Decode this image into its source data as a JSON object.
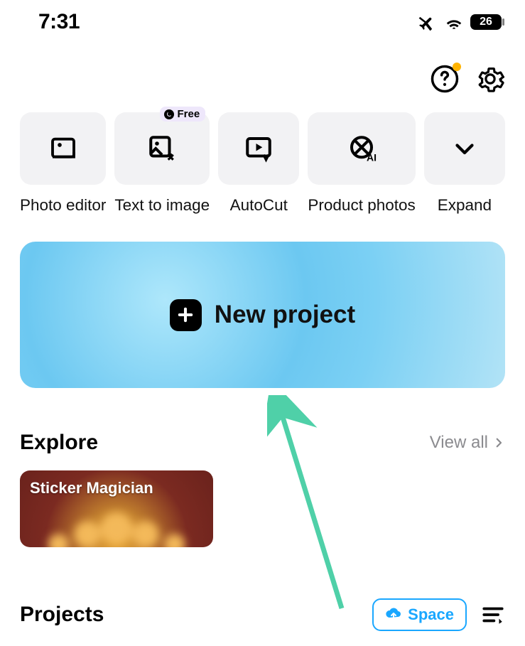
{
  "status": {
    "time": "7:31",
    "battery": "26"
  },
  "tools": [
    {
      "label": "Photo editor",
      "icon": "photo-editor-icon",
      "badge": null
    },
    {
      "label": "Text to image",
      "icon": "text-to-image-icon",
      "badge": "Free"
    },
    {
      "label": "AutoCut",
      "icon": "autocut-icon",
      "badge": null
    },
    {
      "label": "Product photos",
      "icon": "product-photos-icon",
      "badge": null
    },
    {
      "label": "Expand",
      "icon": "expand-icon",
      "badge": null
    }
  ],
  "new_project": {
    "label": "New project"
  },
  "explore": {
    "title": "Explore",
    "view_all": "View all",
    "card_title": "Sticker Magician"
  },
  "projects": {
    "title": "Projects",
    "space_label": "Space"
  }
}
